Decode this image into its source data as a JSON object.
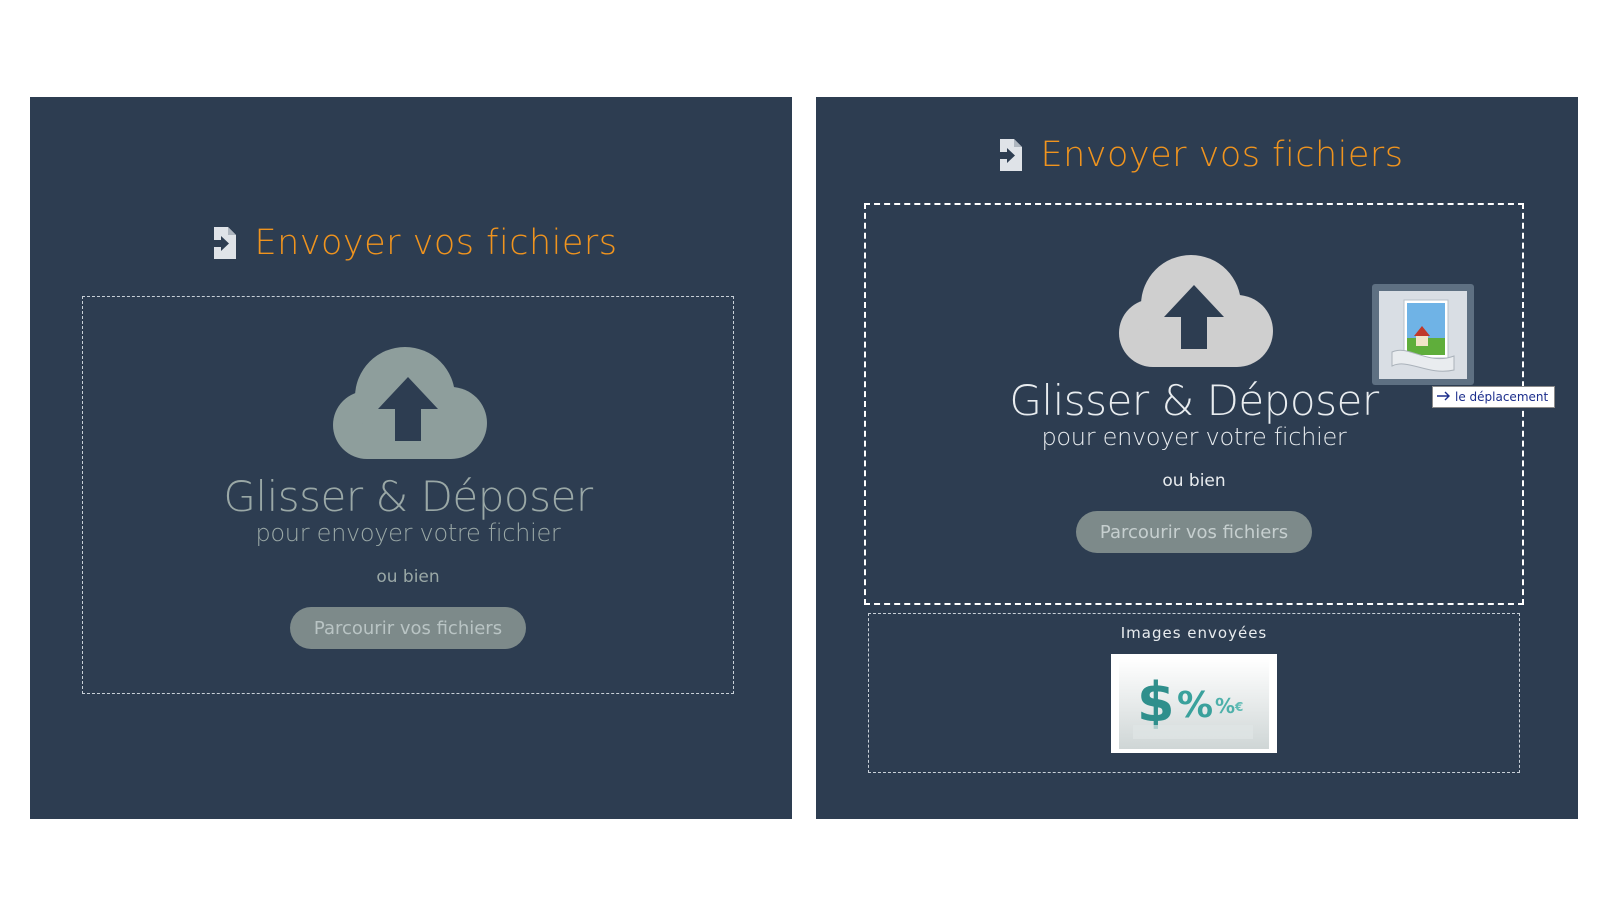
{
  "colors": {
    "panel_bg": "#2d3d51",
    "title_accent": "#f0941e",
    "cloud_left": "#8e9e9c",
    "cloud_right": "#cfcfcf",
    "button_bg": "#7d8a8a"
  },
  "left_panel": {
    "title": "Envoyer vos fichiers",
    "title_icon": "file-import-icon",
    "dropzone": {
      "icon": "cloud-upload-icon",
      "heading": "Glisser & Déposer",
      "subheading": "pour envoyer votre fichier",
      "or_text": "ou bien",
      "browse_label": "Parcourir vos fichiers"
    }
  },
  "right_panel": {
    "title": "Envoyer vos fichiers",
    "title_icon": "file-import-icon",
    "dropzone": {
      "icon": "cloud-upload-icon",
      "heading": "Glisser & Déposer",
      "subheading": "pour envoyer votre fichier",
      "or_text": "ou bien",
      "browse_label": "Parcourir vos fichiers"
    },
    "drag_preview": {
      "icon": "image-file-icon",
      "tooltip": "le déplacement",
      "tooltip_icon": "arrow-right-icon"
    },
    "uploaded": {
      "title": "Images envoyées",
      "thumbnail_icon": "dollar-percent-image"
    }
  }
}
